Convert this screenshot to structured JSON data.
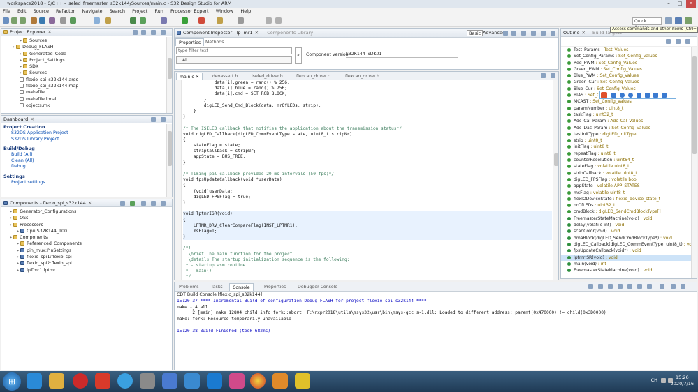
{
  "window": {
    "title": "workspace2018 - C/C++ - iseled_freemaster_s32k144/Sources/main.c - S32 Design Studio for ARM",
    "min": "–",
    "max": "□",
    "close": "✕"
  },
  "menu": [
    "File",
    "Edit",
    "Source",
    "Refactor",
    "Navigate",
    "Search",
    "Project",
    "Run",
    "Processor Expert",
    "Window",
    "Help"
  ],
  "quick_access": {
    "placeholder": "Quick Access",
    "tooltip": "Access commands and other items (Ctrl+3)"
  },
  "project_explorer": {
    "title": "Project Explorer",
    "items": [
      {
        "label": "Sources",
        "indent": 2,
        "type": "folder"
      },
      {
        "label": "Debug_FLASH",
        "indent": 1,
        "type": "folder"
      },
      {
        "label": "Generated_Code",
        "indent": 2,
        "type": "folder"
      },
      {
        "label": "Project_Settings",
        "indent": 2,
        "type": "folder"
      },
      {
        "label": "SDK",
        "indent": 2,
        "type": "folder"
      },
      {
        "label": "Sources",
        "indent": 2,
        "type": "folder"
      },
      {
        "label": "flexio_spi_s32k144.args",
        "indent": 2,
        "type": "file"
      },
      {
        "label": "flexio_spi_s32k144.map",
        "indent": 2,
        "type": "file"
      },
      {
        "label": "makefile",
        "indent": 2,
        "type": "file"
      },
      {
        "label": "makefile.local",
        "indent": 2,
        "type": "file"
      },
      {
        "label": "objects.mk",
        "indent": 2,
        "type": "file"
      }
    ]
  },
  "dashboard": {
    "title": "Dashboard",
    "project_creation": {
      "heading": "Project Creation",
      "links": [
        "S32DS Application Project",
        "S32DS Library Project"
      ]
    },
    "build_debug": {
      "heading": "Build/Debug",
      "links": [
        "Build  (All)",
        "Clean  (All)",
        "Debug"
      ]
    },
    "settings": {
      "heading": "Settings",
      "links": [
        "Project settings"
      ]
    }
  },
  "components": {
    "title": "Components - flexio_spi_s32k144",
    "items": [
      {
        "label": "Generator_Configurations",
        "indent": 1,
        "type": "folder"
      },
      {
        "label": "OSs",
        "indent": 1,
        "type": "folder"
      },
      {
        "label": "Processors",
        "indent": 1,
        "type": "folder"
      },
      {
        "label": "Cpu:S32K144_100",
        "indent": 2,
        "type": "chip"
      },
      {
        "label": "Components",
        "indent": 1,
        "type": "folder"
      },
      {
        "label": "Referenced_Components",
        "indent": 2,
        "type": "folder"
      },
      {
        "label": "pin_mux:PinSettings",
        "indent": 2,
        "type": "chip"
      },
      {
        "label": "flexio_spi1:flexio_spi",
        "indent": 2,
        "type": "chip"
      },
      {
        "label": "flexio_spi2:flexio_spi",
        "indent": 2,
        "type": "chip"
      },
      {
        "label": "lpTmr1:lptmr",
        "indent": 2,
        "type": "chip"
      }
    ]
  },
  "inspector": {
    "title": "Component Inspector - lpTmr1",
    "library_tab": "Components Library",
    "basic": "Basic",
    "advanced": "Advanced",
    "tabs": [
      "Properties",
      "Methods"
    ],
    "filter_placeholder": "type filter text",
    "select_value": "All",
    "version_label": "Component version",
    "version_value": "S32K144_SDK01"
  },
  "editor": {
    "tabs": [
      "main.c",
      "devassert.h",
      "iseled_driver.h",
      "flexcan_driver.c",
      "flexcan_driver.h"
    ],
    "lines": [
      "            data[i].green = rand() % 256;",
      "            data[i].blue = rand() % 256;",
      "            data[i].cmd = SET_RGB_BLOCK;",
      "        }",
      "        digLED_Send_Cmd_Block(data, nrOfLEDs, strip);",
      "    }",
      "}",
      "",
      "/* The ISELED callback that notifies the application about the transmission status*/",
      "void digLED_Callback(digLED_CommEventType state, uint8_t stripNr)",
      "{",
      "    stateFlag = state;",
      "    stripCallback = stripNr;",
      "    appState = BUS_FREE;",
      "}",
      "",
      "/* Timing pal callback provides 20 ms intervals (50 fps)*/",
      "void fpsUpdateCallback(void *userData)",
      "{",
      "    (void)userData;",
      "    digLED_FPSFlag = true;",
      "}",
      "",
      "void lptmrISR(void)",
      "{",
      "    LPTMR_DRV_ClearCompareFlag(INST_LPTMR1);",
      "    msFlag=1;",
      "}",
      "",
      "/*!",
      "  \\brief The main function for the project.",
      "  \\details The startup initialization sequence is the following:",
      " * - startup asm routine",
      " * - main()",
      " */",
      "int main(void)"
    ]
  },
  "outline": {
    "title": "Outline",
    "second_tab": "Build Targets",
    "items": [
      {
        "name": "Test_Params",
        "type": "Test_Values"
      },
      {
        "name": "Set_Config_Params",
        "type": "Set_Config_Values"
      },
      {
        "name": "Red_PWM",
        "type": "Set_Config_Values"
      },
      {
        "name": "Green_PWM",
        "type": "Set_Config_Values"
      },
      {
        "name": "Blue_PWM",
        "type": "Set_Config_Values"
      },
      {
        "name": "Green_Cur",
        "type": "Set_Config_Values"
      },
      {
        "name": "Blue_Cur",
        "type": "Set_Config_Values"
      },
      {
        "name": "BIAS",
        "type": "Set_Config_Values"
      },
      {
        "name": "MCAST",
        "type": "Set_Config_Values"
      },
      {
        "name": "paramNumber",
        "type": "uint8_t"
      },
      {
        "name": "taskFlag",
        "type": "uint32_t"
      },
      {
        "name": "Adc_Cal_Param",
        "type": "Adc_Cal_Values"
      },
      {
        "name": "Adc_Dac_Param",
        "type": "Set_Config_Values"
      },
      {
        "name": "testInitType",
        "type": "digLED_InitType"
      },
      {
        "name": "strip",
        "type": "uint8_t"
      },
      {
        "name": "initFlag",
        "type": "uint8_t"
      },
      {
        "name": "repeatFlag",
        "type": "uint8_t"
      },
      {
        "name": "counterResolution",
        "type": "uint64_t"
      },
      {
        "name": "stateFlag",
        "type": "volatile uint8_t"
      },
      {
        "name": "stripCallback",
        "type": "volatile uint8_t"
      },
      {
        "name": "digLED_FPSFlag",
        "type": "volatile bool"
      },
      {
        "name": "appState",
        "type": "volatile APP_STATES"
      },
      {
        "name": "msFlag",
        "type": "volatile uint8_t"
      },
      {
        "name": "flexIODeviceState",
        "type": "flexio_device_state_t"
      },
      {
        "name": "nrOfLEDs",
        "type": "uint32_t"
      },
      {
        "name": "cmdBlock",
        "type": "digLED_SendCmdBlockType[]"
      },
      {
        "name": "FreemasterStateMachine(void)",
        "type": "void"
      },
      {
        "name": "delay(volatile int)",
        "type": "void"
      },
      {
        "name": "scanColor(void)",
        "type": "void"
      },
      {
        "name": "dmaBlock(digLED_SendCmdBlockType*)",
        "type": "void"
      },
      {
        "name": "digLED_Callback(digLED_CommEventType, uint8_t)",
        "type": "void"
      },
      {
        "name": "fpsUpdateCallback(void*)",
        "type": "void"
      },
      {
        "name": "lptmrISR(void)",
        "type": "void"
      },
      {
        "name": "main(void)",
        "type": "int"
      },
      {
        "name": "FreemasterStateMachine(void)",
        "type": "void"
      }
    ]
  },
  "bottom": {
    "tabs": [
      "Problems",
      "Tasks",
      "Console",
      "Properties",
      "Debugger Console"
    ],
    "console_title": "CDT Build Console [flexio_spi_s32k144]",
    "lines": [
      {
        "text": "15:20:37 **** Incremental Build of configuration Debug_FLASH for project flexio_spi_s32k144 ****",
        "color": "#0000c0"
      },
      {
        "text": "make -j4 all",
        "color": "#111111"
      },
      {
        "text": "      2 [main] make 12804 child_info_fork::abort: F:\\nxpr2018\\utils\\msys32\\usr\\bin\\msys-gcc_s-1.dll: Loaded to different address: parent(0x470000) != child(0x3D0000)",
        "color": "#111111"
      },
      {
        "text": "make: fork: Resource temporarily unavailable",
        "color": "#111111"
      },
      {
        "text": "",
        "color": "#111111"
      },
      {
        "text": "15:20:38 Build Finished (took 682ms)",
        "color": "#0000c0"
      }
    ]
  },
  "taskbar": {
    "start": "⊞",
    "time": "15:26",
    "date": "2020/7/16",
    "lang": "CH"
  }
}
